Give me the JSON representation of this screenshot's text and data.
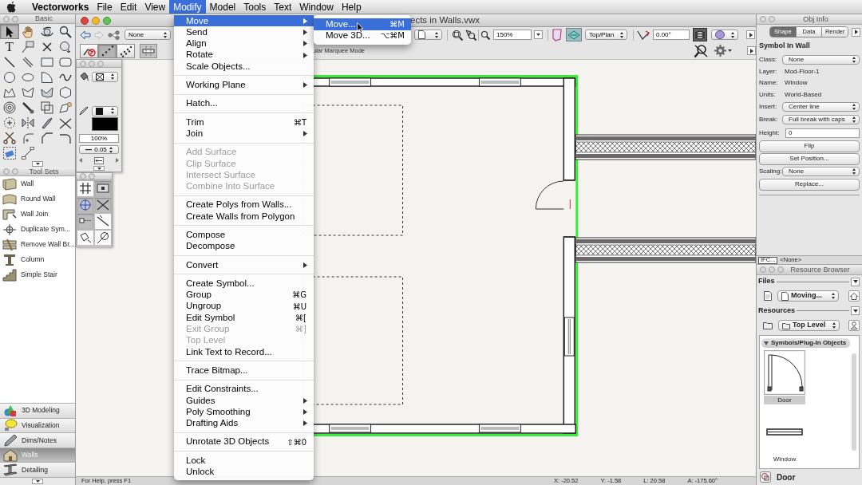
{
  "menu_bar": {
    "app": "Vectorworks",
    "menus": [
      {
        "label": "File",
        "selected": false
      },
      {
        "label": "Edit",
        "selected": false
      },
      {
        "label": "View",
        "selected": false
      },
      {
        "label": "Modify",
        "selected": true
      },
      {
        "label": "Model",
        "selected": false
      },
      {
        "label": "Tools",
        "selected": false
      },
      {
        "label": "Text",
        "selected": false
      },
      {
        "label": "Window",
        "selected": false
      },
      {
        "label": "Help",
        "selected": false
      }
    ]
  },
  "modify_menu": {
    "sections": [
      {
        "items": [
          {
            "label": "Move",
            "selected": true,
            "disabled": false,
            "submenu": true
          },
          {
            "label": "Send",
            "selected": false,
            "disabled": false,
            "submenu": true
          },
          {
            "label": "Align",
            "selected": false,
            "disabled": false,
            "submenu": true
          },
          {
            "label": "Rotate",
            "selected": false,
            "disabled": false,
            "submenu": true
          },
          {
            "label": "Scale Objects...",
            "selected": false,
            "disabled": false,
            "submenu": false
          }
        ]
      },
      {
        "items": [
          {
            "label": "Working Plane",
            "selected": false,
            "disabled": false,
            "submenu": true
          }
        ]
      },
      {
        "items": [
          {
            "label": "Hatch...",
            "selected": false,
            "disabled": false,
            "submenu": false
          }
        ]
      },
      {
        "items": [
          {
            "label": "Trim",
            "shortcut": "⌘T",
            "selected": false,
            "disabled": false,
            "submenu": false
          },
          {
            "label": "Join",
            "selected": false,
            "disabled": false,
            "submenu": true
          }
        ]
      },
      {
        "items": [
          {
            "label": "Add Surface",
            "selected": false,
            "disabled": true,
            "submenu": false
          },
          {
            "label": "Clip Surface",
            "selected": false,
            "disabled": true,
            "submenu": false
          },
          {
            "label": "Intersect Surface",
            "selected": false,
            "disabled": true,
            "submenu": false
          },
          {
            "label": "Combine Into Surface",
            "selected": false,
            "disabled": true,
            "submenu": false
          }
        ]
      },
      {
        "items": [
          {
            "label": "Create Polys from Walls...",
            "selected": false,
            "disabled": false,
            "submenu": false
          },
          {
            "label": "Create Walls from Polygon",
            "selected": false,
            "disabled": false,
            "submenu": false
          }
        ]
      },
      {
        "items": [
          {
            "label": "Compose",
            "selected": false,
            "disabled": false,
            "submenu": false
          },
          {
            "label": "Decompose",
            "selected": false,
            "disabled": false,
            "submenu": false
          }
        ]
      },
      {
        "items": [
          {
            "label": "Convert",
            "selected": false,
            "disabled": false,
            "submenu": true
          }
        ]
      },
      {
        "items": [
          {
            "label": "Create Symbol...",
            "selected": false,
            "disabled": false,
            "submenu": false
          },
          {
            "label": "Group",
            "shortcut": "⌘G",
            "selected": false,
            "disabled": false,
            "submenu": false
          },
          {
            "label": "Ungroup",
            "shortcut": "⌘U",
            "selected": false,
            "disabled": false,
            "submenu": false
          },
          {
            "label": "Edit Symbol",
            "shortcut": "⌘[",
            "selected": false,
            "disabled": false,
            "submenu": false
          },
          {
            "label": "Exit Group",
            "shortcut": "⌘]",
            "selected": false,
            "disabled": true,
            "submenu": false
          },
          {
            "label": "Top Level",
            "selected": false,
            "disabled": true,
            "submenu": false
          },
          {
            "label": "Link Text to Record...",
            "selected": false,
            "disabled": false,
            "submenu": false
          }
        ]
      },
      {
        "items": [
          {
            "label": "Trace Bitmap...",
            "selected": false,
            "disabled": false,
            "submenu": false
          }
        ]
      },
      {
        "items": [
          {
            "label": "Edit Constraints...",
            "selected": false,
            "disabled": false,
            "submenu": false
          },
          {
            "label": "Guides",
            "selected": false,
            "disabled": false,
            "submenu": true
          },
          {
            "label": "Poly Smoothing",
            "selected": false,
            "disabled": false,
            "submenu": true
          },
          {
            "label": "Drafting Aids",
            "selected": false,
            "disabled": false,
            "submenu": true
          }
        ]
      },
      {
        "items": [
          {
            "label": "Unrotate 3D Objects",
            "shortcut": "⇧⌘0",
            "selected": false,
            "disabled": false,
            "submenu": false
          }
        ]
      },
      {
        "items": [
          {
            "label": "Lock",
            "selected": false,
            "disabled": false,
            "submenu": false
          },
          {
            "label": "Unlock",
            "selected": false,
            "disabled": false,
            "submenu": false
          }
        ]
      }
    ]
  },
  "move_submenu": {
    "items": [
      {
        "label": "Move...",
        "shortcut": "⌘M",
        "selected": true
      },
      {
        "label": "Move 3D...",
        "shortcut": "⌥⌘M",
        "selected": false
      }
    ]
  },
  "basic_palette": {
    "title": "Basic",
    "tools": [
      {
        "kind": "pointer",
        "selected": true
      },
      {
        "kind": "hand",
        "selected": false
      },
      {
        "kind": "orbit",
        "selected": false
      },
      {
        "kind": "zoom",
        "selected": false
      },
      {
        "kind": "text",
        "glyph": "T",
        "selected": false
      },
      {
        "kind": "callout",
        "selected": false
      },
      {
        "kind": "locus",
        "selected": false
      },
      {
        "kind": "sphere",
        "selected": false
      },
      {
        "kind": "line",
        "selected": false
      },
      {
        "kind": "wall",
        "selected": false
      },
      {
        "kind": "rectangle",
        "selected": false
      },
      {
        "kind": "rounded",
        "selected": false
      },
      {
        "kind": "circle",
        "selected": false
      },
      {
        "kind": "oval",
        "selected": false
      },
      {
        "kind": "arc",
        "selected": false
      },
      {
        "kind": "freehand",
        "selected": false
      },
      {
        "kind": "polyline",
        "selected": false
      },
      {
        "kind": "polygon",
        "selected": false
      },
      {
        "kind": "surface",
        "selected": false
      },
      {
        "kind": "hexagon",
        "selected": false
      },
      {
        "kind": "spiral",
        "selected": false
      },
      {
        "kind": "eyedropper",
        "selected": false
      },
      {
        "kind": "offset",
        "selected": false
      },
      {
        "kind": "reshape",
        "selected": false
      },
      {
        "kind": "rotate",
        "selected": false
      },
      {
        "kind": "mirror",
        "selected": false
      },
      {
        "kind": "knife",
        "selected": false
      },
      {
        "kind": "trim",
        "selected": false
      },
      {
        "kind": "split",
        "selected": false
      },
      {
        "kind": "fillet",
        "selected": false
      },
      {
        "kind": "chamfer",
        "selected": false
      },
      {
        "kind": "connect",
        "selected": false
      },
      {
        "kind": "eraser",
        "selected": false
      },
      {
        "kind": "dimension",
        "selected": false
      }
    ]
  },
  "tool_sets_palette": {
    "title": "Tool Sets",
    "tools": [
      {
        "label": "Wall",
        "kind": "wall"
      },
      {
        "label": "Round Wall",
        "kind": "roundwall"
      },
      {
        "label": "Wall Join",
        "kind": "join"
      },
      {
        "label": "Duplicate Sym...",
        "kind": "duplicate"
      },
      {
        "label": "Remove Wall Br...",
        "kind": "removebreak"
      },
      {
        "label": "Column",
        "kind": "column"
      },
      {
        "label": "Simple Stair",
        "kind": "stair"
      }
    ],
    "sets": [
      {
        "label": "3D Modeling",
        "kind": "modeling",
        "selected": false
      },
      {
        "label": "Visualization",
        "kind": "bulb",
        "selected": false
      },
      {
        "label": "Dims/Notes",
        "kind": "pencil",
        "selected": false
      },
      {
        "label": "Walls",
        "kind": "house",
        "selected": true
      },
      {
        "label": "Detailing",
        "kind": "beam",
        "selected": false
      }
    ]
  },
  "document": {
    "title": "ects in Walls.vwx",
    "class_menu": "None",
    "zoom": "150%",
    "view": "Top/Plan",
    "rotation": "0.00°",
    "toolbar_toggles": [
      {
        "kind": "plane",
        "on": true
      },
      {
        "kind": "layers",
        "on": true
      }
    ],
    "mode_buttons": [
      {
        "kind": "nosnap",
        "on": false
      },
      {
        "kind": "snap",
        "on": true
      },
      {
        "kind": "snapall",
        "on": false
      }
    ],
    "mode_hint": "ular Marquee Mode",
    "status": "For Help, press F1",
    "coordinates": [
      "X: -20.52",
      "Y: -1.58",
      "L: 20.58",
      "A: -175.60°"
    ]
  },
  "attributes_palette": {
    "opacity": "100%",
    "line_weight": "0.05"
  },
  "snaps_palette": {
    "buttons": [
      {
        "kind": "grid",
        "on": false
      },
      {
        "kind": "object",
        "on": true
      },
      {
        "kind": "center",
        "on": true
      },
      {
        "kind": "intersection",
        "on": true
      },
      {
        "kind": "distance",
        "on": true
      },
      {
        "kind": "tangent",
        "on": false
      },
      {
        "kind": "point",
        "on": false
      },
      {
        "kind": "smart",
        "on": false
      }
    ]
  },
  "obj_info": {
    "title": "Obj Info",
    "tabs": [
      {
        "label": "Shape",
        "selected": true
      },
      {
        "label": "Data",
        "selected": false
      },
      {
        "label": "Render",
        "selected": false
      }
    ],
    "heading": "Symbol In Wall",
    "rows": [
      {
        "kind": "select",
        "label": "Class:",
        "value": "None"
      },
      {
        "kind": "text",
        "label": "Layer:",
        "value": "Mod-Floor-1"
      },
      {
        "kind": "text",
        "label": "Name:",
        "value": "Window"
      },
      {
        "kind": "text",
        "label": "Units:",
        "value": "World-Based"
      },
      {
        "kind": "select",
        "label": "Insert:",
        "value": "Center line"
      },
      {
        "kind": "select",
        "label": "Break:",
        "value": "Full break with caps"
      },
      {
        "kind": "input",
        "label": "Height:",
        "value": "0"
      },
      {
        "kind": "button",
        "label": "Flip"
      },
      {
        "kind": "button",
        "label": "Set Position..."
      },
      {
        "kind": "select",
        "label": "Scaling:",
        "value": "None"
      },
      {
        "kind": "button",
        "label": "Replace..."
      }
    ],
    "ifc_button": "IFC...",
    "ifc_value": "<None>"
  },
  "resource_browser": {
    "title": "Resource Browser",
    "files_label": "Files",
    "file": "Moving...",
    "resources_label": "Resources",
    "location": "Top Level",
    "category": {
      "label": "Symbols/Plug-In Objects",
      "expanded": true
    },
    "items": [
      {
        "label": "Door",
        "kind": "door",
        "selected": true
      },
      {
        "label": "Window",
        "kind": "window",
        "selected": false
      }
    ],
    "footer": "Door"
  }
}
